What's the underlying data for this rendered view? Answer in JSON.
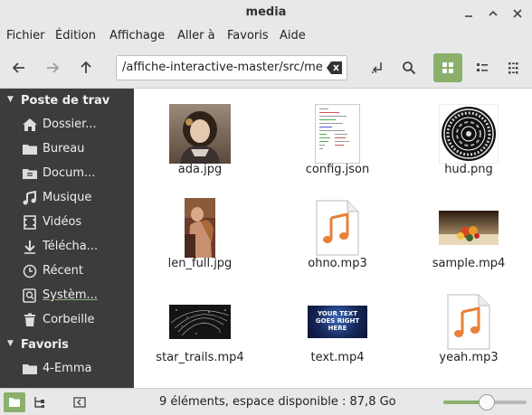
{
  "window": {
    "title": "media"
  },
  "menu": [
    "Fichier",
    "Édition",
    "Affichage",
    "Aller à",
    "Favoris",
    "Aide"
  ],
  "toolbar": {
    "path": "/affiche-interactive-master/src/media"
  },
  "sidebar": {
    "sections": [
      {
        "label": "Poste de trav"
      },
      {
        "label": "Favoris"
      }
    ],
    "items": [
      {
        "label": "Dossier...",
        "icon": "home-icon"
      },
      {
        "label": "Bureau",
        "icon": "folder-icon"
      },
      {
        "label": "Docum...",
        "icon": "document-icon"
      },
      {
        "label": "Musique",
        "icon": "music-icon"
      },
      {
        "label": "Vidéos",
        "icon": "video-icon"
      },
      {
        "label": "Télécha...",
        "icon": "download-icon"
      },
      {
        "label": "Récent",
        "icon": "clock-icon"
      },
      {
        "label": "Systèm...",
        "icon": "drive-icon"
      },
      {
        "label": "Corbeille",
        "icon": "trash-icon"
      },
      {
        "label": "4-Emma",
        "icon": "folder-icon"
      }
    ]
  },
  "files": [
    {
      "name": "ada.jpg",
      "kind": "portrait-image"
    },
    {
      "name": "config.json",
      "kind": "text-document"
    },
    {
      "name": "hud.png",
      "kind": "hud-image"
    },
    {
      "name": "len_full.jpg",
      "kind": "painting-image"
    },
    {
      "name": "ohno.mp3",
      "kind": "audio"
    },
    {
      "name": "sample.mp4",
      "kind": "video-thumbnail"
    },
    {
      "name": "star_trails.mp4",
      "kind": "video-thumbnail"
    },
    {
      "name": "text.mp4",
      "kind": "video-thumbnail"
    },
    {
      "name": "yeah.mp3",
      "kind": "audio"
    }
  ],
  "video_text": "YOUR TEXT GOES RIGHT HERE",
  "status": {
    "text": "9 éléments, espace disponible : 87,8 Go",
    "zoom_level": 0.52
  },
  "colors": {
    "accent": "#8ab06c",
    "sidebar_bg": "#3c3c3c",
    "audio_orange": "#e8803a"
  }
}
